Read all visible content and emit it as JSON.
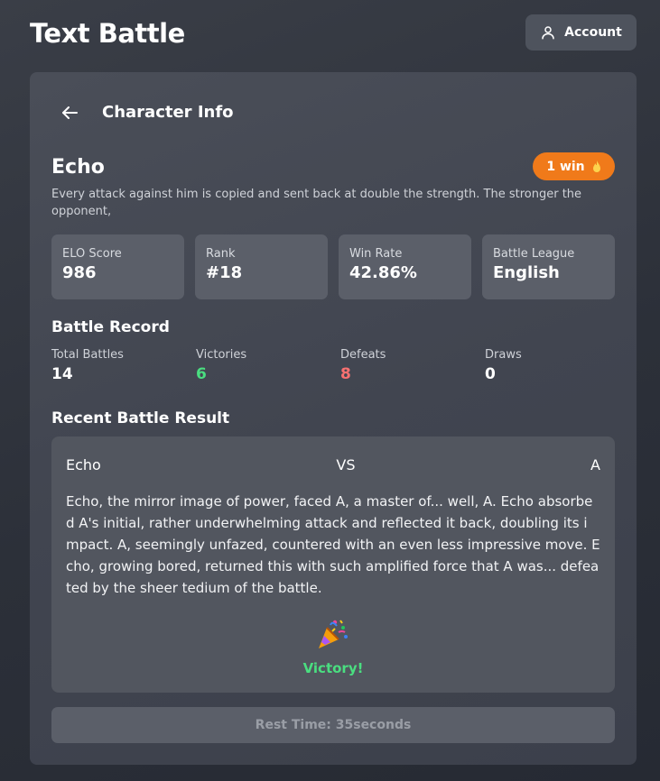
{
  "app": {
    "title": "Text Battle"
  },
  "header": {
    "account_label": "Account"
  },
  "card": {
    "title": "Character Info"
  },
  "character": {
    "name": "Echo",
    "wins_badge": "1 win",
    "description": "Every attack against him is copied and sent back at double the strength. The stronger the opponent,"
  },
  "stats": [
    {
      "label": "ELO Score",
      "value": "986"
    },
    {
      "label": "Rank",
      "value": "#18"
    },
    {
      "label": "Win Rate",
      "value": "42.86%"
    },
    {
      "label": "Battle League",
      "value": "English"
    }
  ],
  "battle_record": {
    "title": "Battle Record",
    "items": [
      {
        "label": "Total Battles",
        "value": "14",
        "color": "#ffffff"
      },
      {
        "label": "Victories",
        "value": "6",
        "color": "#4ade80"
      },
      {
        "label": "Defeats",
        "value": "8",
        "color": "#f87171"
      },
      {
        "label": "Draws",
        "value": "0",
        "color": "#ffffff"
      }
    ]
  },
  "recent": {
    "title": "Recent Battle Result",
    "left": "Echo",
    "vs": "VS",
    "right": "A",
    "text": "Echo, the mirror image of power, faced A, a master of... well, A. Echo absorbed A's initial, rather underwhelming attack and reflected it back, doubling its impact. A, seemingly unfazed, countered with an even less impressive move. Echo, growing bored, returned this with such amplified force that A was... defeated by the sheer tedium of the battle.",
    "result_icon": "party-popper-icon",
    "result": "Victory!"
  },
  "footer": {
    "rest_time": "Rest Time: 35seconds"
  },
  "colors": {
    "badge": "#f07a1a",
    "victory": "#4ade80",
    "defeat": "#f87171"
  }
}
